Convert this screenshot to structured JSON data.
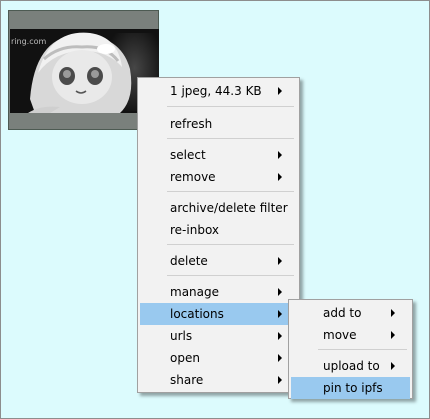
{
  "thumbnail": {
    "watermark": "ring.com"
  },
  "context_menu": {
    "file_info": "1 jpeg, 44.3 KB",
    "refresh": "refresh",
    "select": "select",
    "remove": "remove",
    "archive_delete_filter": "archive/delete filter",
    "re_inbox": "re-inbox",
    "delete": "delete",
    "manage": "manage",
    "locations": "locations",
    "urls": "urls",
    "open": "open",
    "share": "share"
  },
  "locations_submenu": {
    "add_to": "add to",
    "move": "move",
    "upload_to": "upload to",
    "pin_to_ipfs": "pin to ipfs"
  },
  "colors": {
    "pane_background": "#dcfbfd",
    "menu_background": "#f2f2f2",
    "highlight": "#99c9ef"
  }
}
